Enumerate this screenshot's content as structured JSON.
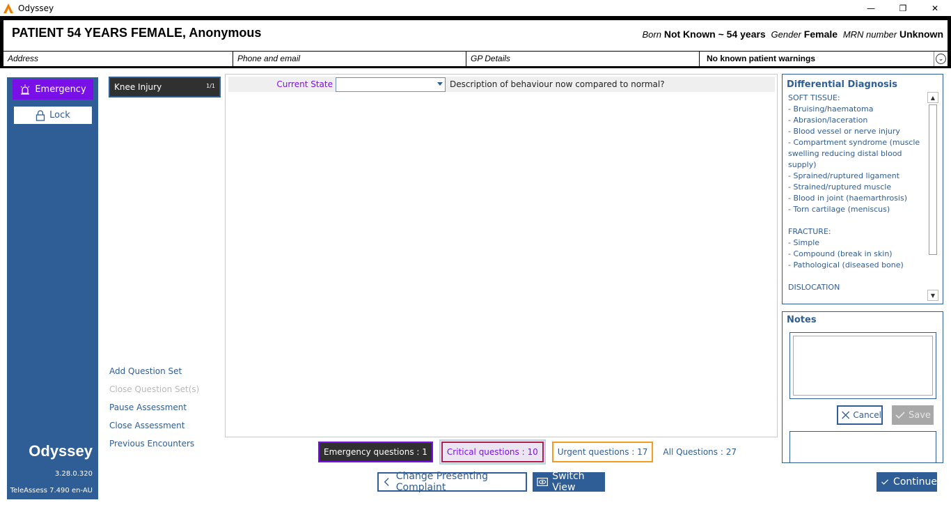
{
  "window": {
    "title": "Odyssey",
    "minimize": "—",
    "maximize": "❐",
    "close": "✕"
  },
  "patient": {
    "name": "PATIENT 54 YEARS FEMALE, Anonymous",
    "born_label": "Born",
    "born_value": "Not Known ~ 54 years",
    "gender_label": "Gender",
    "gender_value": "Female",
    "mrn_label": "MRN number",
    "mrn_value": "Unknown",
    "address": "Address",
    "phone": "Phone and email",
    "gp": "GP Details",
    "warnings": "No known patient warnings"
  },
  "sidebar": {
    "emergency": "Emergency",
    "lock": "Lock",
    "brand": "Odyssey",
    "version": "3.28.0.320",
    "teleassess": "TeleAssess 7.490 en-AU"
  },
  "question_set": {
    "name": "Knee Injury",
    "count": "1/1"
  },
  "side_links": {
    "add": "Add Question Set",
    "close_sets": "Close Question Set(s)",
    "pause": "Pause Assessment",
    "close": "Close Assessment",
    "previous": "Previous Encounters"
  },
  "question": {
    "label": "Current State",
    "value": "",
    "description": "Description of behaviour now compared to normal?"
  },
  "counters": {
    "emergency": "Emergency questions : 1",
    "critical": "Critical questions : 10",
    "urgent": "Urgent questions : 17",
    "all": "All Questions : 27"
  },
  "actions": {
    "change": "Change Presenting Complaint",
    "switch": "Switch View",
    "continue": "Continue"
  },
  "differential": {
    "title": "Differential Diagnosis",
    "lines": [
      "SOFT TISSUE:",
      "- Bruising/haematoma",
      "- Abrasion/laceration",
      "- Blood vessel or nerve injury",
      "- Compartment syndrome (muscle swelling reducing distal blood supply)",
      "- Sprained/ruptured ligament",
      "- Strained/ruptured muscle",
      "- Blood in joint (haemarthrosis)",
      "- Torn cartilage (meniscus)",
      "",
      "FRACTURE:",
      "- Simple",
      "- Compound (break in skin)",
      "- Pathological (diseased bone)",
      "",
      "DISLOCATION"
    ]
  },
  "notes": {
    "title": "Notes",
    "cancel": "Cancel",
    "save": "Save"
  },
  "colors": {
    "brand_blue": "#2f5d95",
    "emergency_purple": "#7a10e8",
    "critical_red": "#b31c4a",
    "urgent_orange": "#f39c22"
  }
}
